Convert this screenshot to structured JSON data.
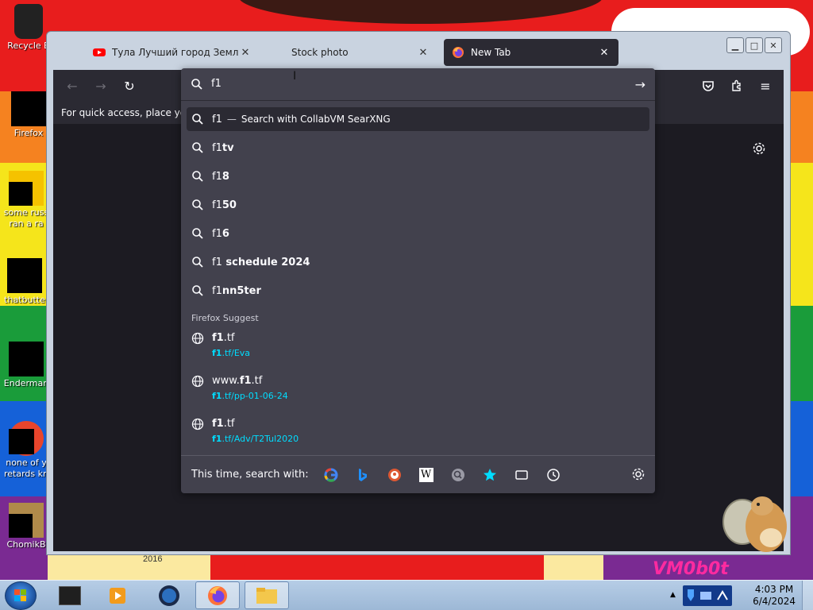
{
  "desktop": {
    "icons": [
      {
        "label": "Recycle B"
      },
      {
        "label": "Firefox"
      },
      {
        "label": "some russ",
        "label2": "ran a ra"
      },
      {
        "label": "thatbutte"
      },
      {
        "label": "Enderman"
      },
      {
        "label": "none of y",
        "label2": "retards kn"
      },
      {
        "label": "ChomikB"
      }
    ],
    "watermark": "VM0b0t",
    "art_text": "2016"
  },
  "browser": {
    "tabs": [
      {
        "title": "Тула Лучший город Земли - Y",
        "icon": "youtube-icon"
      },
      {
        "title": "Stock photo",
        "icon": "none"
      },
      {
        "title": "New Tab",
        "icon": "firefox-icon"
      }
    ],
    "bookmarks_hint": "For quick access, place your b",
    "urlbar": {
      "value": "f1",
      "first_row": {
        "typed": "f1",
        "dash": "—",
        "action": "Search with CollabVM SearXNG"
      },
      "suggestions": [
        {
          "typed": "f1",
          "rest": "tv"
        },
        {
          "typed": "f1",
          "rest": "8"
        },
        {
          "typed": "f1",
          "rest": "50"
        },
        {
          "typed": "f1",
          "rest": "6"
        },
        {
          "typed": "f1",
          "rest": " schedule 2024"
        },
        {
          "typed": "f1",
          "rest": "nn5ter"
        }
      ],
      "firefox_suggest_header": "Firefox Suggest",
      "sites": [
        {
          "title_pre": "",
          "title_bold": "f1",
          "title_post": ".tf",
          "url_bold": "f1",
          "url_post": ".tf/Eva"
        },
        {
          "title_pre": "www.",
          "title_bold": "f1",
          "title_post": ".tf",
          "url_bold": "f1",
          "url_post": ".tf/pp-01-06-24"
        },
        {
          "title_pre": "",
          "title_bold": "f1",
          "title_post": ".tf",
          "url_bold": "f1",
          "url_post": ".tf/Adv/T2Tul2020"
        }
      ],
      "oneoff_label": "This time, search with:",
      "engines": [
        "google-icon",
        "bing-icon",
        "duckduckgo-icon",
        "wikipedia-icon",
        "searxng-icon",
        "bookmarks-star-icon",
        "tabs-icon",
        "history-icon"
      ]
    }
  },
  "taskbar": {
    "time": "4:03 PM",
    "date": "6/4/2024"
  },
  "colors": {
    "accent_link": "#00ddff",
    "firefox_dark": "#2b2a33",
    "dropdown_bg": "#42414d"
  }
}
